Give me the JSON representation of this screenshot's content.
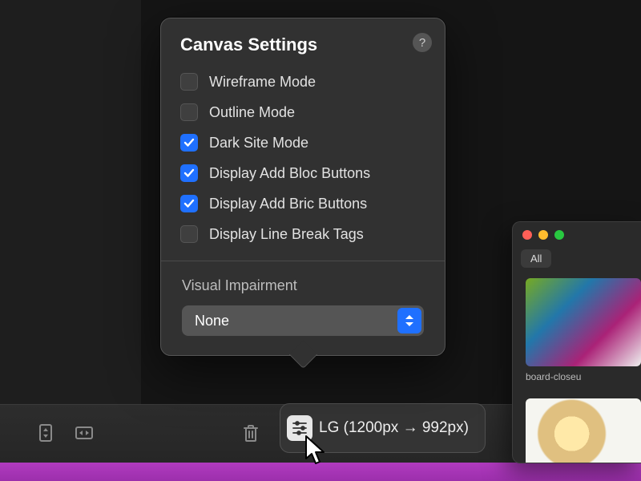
{
  "popover": {
    "title": "Canvas Settings",
    "help": "?",
    "options": [
      {
        "label": "Wireframe Mode",
        "checked": false
      },
      {
        "label": "Outline Mode",
        "checked": false
      },
      {
        "label": "Dark Site Mode",
        "checked": true
      },
      {
        "label": "Display Add Bloc Buttons",
        "checked": true
      },
      {
        "label": "Display Add Bric Buttons",
        "checked": true
      },
      {
        "label": "Display Line Break Tags",
        "checked": false
      }
    ],
    "visual_impairment": {
      "label": "Visual Impairment",
      "value": "None"
    }
  },
  "breakpoint": {
    "label": "LG (1200px → 992px)"
  },
  "side_panel": {
    "tab": "All",
    "thumb1_label": "board-closeu",
    "traffic": {
      "close": "#ff5f57",
      "min": "#febc2e",
      "max": "#28c840"
    }
  }
}
